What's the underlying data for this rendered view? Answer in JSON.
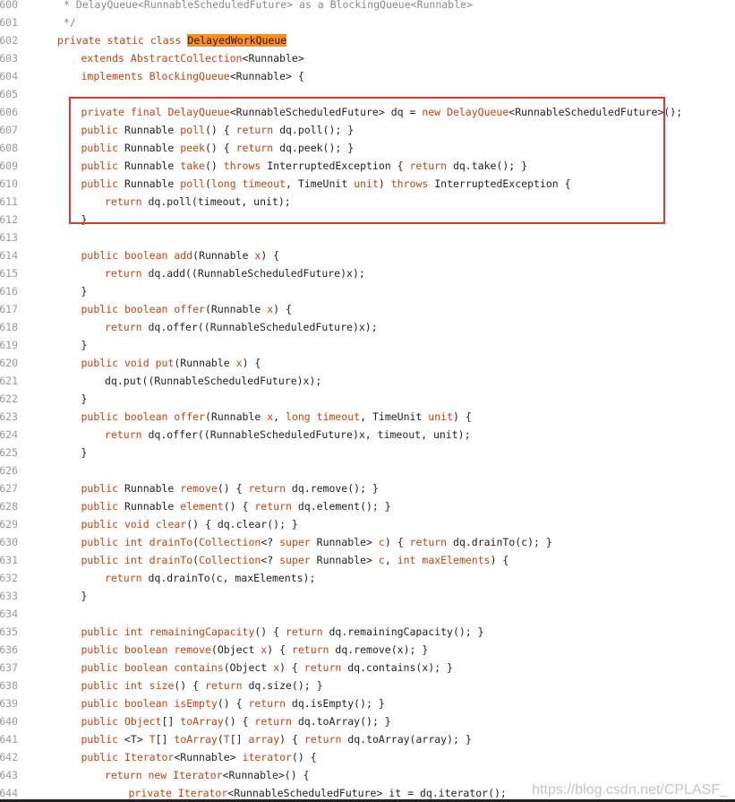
{
  "editor": {
    "lines": [
      {
        "num": "600",
        "indent": 0,
        "tokens": [
          [
            "cm",
            " * DelayQueue<RunnableScheduledFuture> as a BlockingQueue<Runnable>"
          ]
        ]
      },
      {
        "num": "601",
        "indent": 0,
        "tokens": [
          [
            "cm",
            " */"
          ]
        ]
      },
      {
        "num": "602",
        "indent": 0,
        "tokens": [
          [
            "kw",
            "private static class "
          ],
          [
            "hl",
            "DelayedWorkQueue"
          ]
        ]
      },
      {
        "num": "603",
        "indent": 1,
        "tokens": [
          [
            "kw",
            "extends "
          ],
          [
            "ty",
            "AbstractCollection"
          ],
          [
            "pl",
            "<Runnable>"
          ]
        ]
      },
      {
        "num": "604",
        "indent": 1,
        "tokens": [
          [
            "kw",
            "implements "
          ],
          [
            "ty",
            "BlockingQueue"
          ],
          [
            "pl",
            "<Runnable> {"
          ]
        ]
      },
      {
        "num": "605",
        "indent": 0,
        "tokens": []
      },
      {
        "num": "606",
        "indent": 1,
        "tokens": [
          [
            "kw",
            "private final "
          ],
          [
            "ty",
            "DelayQueue"
          ],
          [
            "pl",
            "<RunnableScheduledFuture> dq = "
          ],
          [
            "kw",
            "new "
          ],
          [
            "ty",
            "DelayQueue"
          ],
          [
            "pl",
            "<RunnableScheduledFuture>();"
          ]
        ]
      },
      {
        "num": "607",
        "indent": 1,
        "tokens": [
          [
            "kw",
            "public "
          ],
          [
            "pl",
            "Runnable "
          ],
          [
            "fn",
            "poll"
          ],
          [
            "pl",
            "() { "
          ],
          [
            "kw",
            "return "
          ],
          [
            "pl",
            "dq.poll(); }"
          ]
        ]
      },
      {
        "num": "608",
        "indent": 1,
        "tokens": [
          [
            "kw",
            "public "
          ],
          [
            "pl",
            "Runnable "
          ],
          [
            "fn",
            "peek"
          ],
          [
            "pl",
            "() { "
          ],
          [
            "kw",
            "return "
          ],
          [
            "pl",
            "dq.peek(); }"
          ]
        ]
      },
      {
        "num": "609",
        "indent": 1,
        "tokens": [
          [
            "kw",
            "public "
          ],
          [
            "pl",
            "Runnable "
          ],
          [
            "fn",
            "take"
          ],
          [
            "pl",
            "() "
          ],
          [
            "kw",
            "throws "
          ],
          [
            "pl",
            "InterruptedException { "
          ],
          [
            "kw",
            "return "
          ],
          [
            "pl",
            "dq.take(); }"
          ]
        ]
      },
      {
        "num": "610",
        "indent": 1,
        "tokens": [
          [
            "kw",
            "public "
          ],
          [
            "pl",
            "Runnable "
          ],
          [
            "fn",
            "poll"
          ],
          [
            "pl",
            "("
          ],
          [
            "kw",
            "long "
          ],
          [
            "vr",
            "timeout"
          ],
          [
            "pl",
            ", TimeUnit "
          ],
          [
            "vr",
            "unit"
          ],
          [
            "pl",
            ") "
          ],
          [
            "kw",
            "throws "
          ],
          [
            "pl",
            "InterruptedException {"
          ]
        ]
      },
      {
        "num": "611",
        "indent": 2,
        "tokens": [
          [
            "kw",
            "return "
          ],
          [
            "pl",
            "dq.poll(timeout, unit);"
          ]
        ]
      },
      {
        "num": "612",
        "indent": 1,
        "tokens": [
          [
            "pl",
            "}"
          ]
        ]
      },
      {
        "num": "613",
        "indent": 0,
        "tokens": []
      },
      {
        "num": "614",
        "indent": 1,
        "tokens": [
          [
            "kw",
            "public boolean "
          ],
          [
            "fn",
            "add"
          ],
          [
            "pl",
            "(Runnable "
          ],
          [
            "vr",
            "x"
          ],
          [
            "pl",
            ") {"
          ]
        ]
      },
      {
        "num": "615",
        "indent": 2,
        "tokens": [
          [
            "kw",
            "return "
          ],
          [
            "pl",
            "dq.add((RunnableScheduledFuture)x);"
          ]
        ]
      },
      {
        "num": "616",
        "indent": 1,
        "tokens": [
          [
            "pl",
            "}"
          ]
        ]
      },
      {
        "num": "617",
        "indent": 1,
        "tokens": [
          [
            "kw",
            "public boolean "
          ],
          [
            "fn",
            "offer"
          ],
          [
            "pl",
            "(Runnable "
          ],
          [
            "vr",
            "x"
          ],
          [
            "pl",
            ") {"
          ]
        ]
      },
      {
        "num": "618",
        "indent": 2,
        "tokens": [
          [
            "kw",
            "return "
          ],
          [
            "pl",
            "dq.offer((RunnableScheduledFuture)x);"
          ]
        ]
      },
      {
        "num": "619",
        "indent": 1,
        "tokens": [
          [
            "pl",
            "}"
          ]
        ]
      },
      {
        "num": "620",
        "indent": 1,
        "tokens": [
          [
            "kw",
            "public void "
          ],
          [
            "fn",
            "put"
          ],
          [
            "pl",
            "(Runnable "
          ],
          [
            "vr",
            "x"
          ],
          [
            "pl",
            ") {"
          ]
        ]
      },
      {
        "num": "621",
        "indent": 2,
        "tokens": [
          [
            "pl",
            "dq.put((RunnableScheduledFuture)x);"
          ]
        ]
      },
      {
        "num": "622",
        "indent": 1,
        "tokens": [
          [
            "pl",
            "}"
          ]
        ]
      },
      {
        "num": "623",
        "indent": 1,
        "tokens": [
          [
            "kw",
            "public boolean "
          ],
          [
            "fn",
            "offer"
          ],
          [
            "pl",
            "(Runnable "
          ],
          [
            "vr",
            "x"
          ],
          [
            "pl",
            ", "
          ],
          [
            "kw",
            "long "
          ],
          [
            "vr",
            "timeout"
          ],
          [
            "pl",
            ", TimeUnit "
          ],
          [
            "vr",
            "unit"
          ],
          [
            "pl",
            ") {"
          ]
        ]
      },
      {
        "num": "624",
        "indent": 2,
        "tokens": [
          [
            "kw",
            "return "
          ],
          [
            "pl",
            "dq.offer((RunnableScheduledFuture)x, timeout, unit);"
          ]
        ]
      },
      {
        "num": "625",
        "indent": 1,
        "tokens": [
          [
            "pl",
            "}"
          ]
        ]
      },
      {
        "num": "626",
        "indent": 0,
        "tokens": []
      },
      {
        "num": "627",
        "indent": 1,
        "tokens": [
          [
            "kw",
            "public "
          ],
          [
            "pl",
            "Runnable "
          ],
          [
            "fn",
            "remove"
          ],
          [
            "pl",
            "() { "
          ],
          [
            "kw",
            "return "
          ],
          [
            "pl",
            "dq.remove(); }"
          ]
        ]
      },
      {
        "num": "628",
        "indent": 1,
        "tokens": [
          [
            "kw",
            "public "
          ],
          [
            "pl",
            "Runnable "
          ],
          [
            "fn",
            "element"
          ],
          [
            "pl",
            "() { "
          ],
          [
            "kw",
            "return "
          ],
          [
            "pl",
            "dq.element(); }"
          ]
        ]
      },
      {
        "num": "629",
        "indent": 1,
        "tokens": [
          [
            "kw",
            "public void "
          ],
          [
            "fn",
            "clear"
          ],
          [
            "pl",
            "() { dq.clear(); }"
          ]
        ]
      },
      {
        "num": "630",
        "indent": 1,
        "tokens": [
          [
            "kw",
            "public int "
          ],
          [
            "fn",
            "drainTo"
          ],
          [
            "pl",
            "("
          ],
          [
            "ty",
            "Collection"
          ],
          [
            "pl",
            "<? "
          ],
          [
            "kw",
            "super "
          ],
          [
            "pl",
            "Runnable> "
          ],
          [
            "vr",
            "c"
          ],
          [
            "pl",
            ") { "
          ],
          [
            "kw",
            "return "
          ],
          [
            "pl",
            "dq.drainTo(c); }"
          ]
        ]
      },
      {
        "num": "631",
        "indent": 1,
        "tokens": [
          [
            "kw",
            "public int "
          ],
          [
            "fn",
            "drainTo"
          ],
          [
            "pl",
            "("
          ],
          [
            "ty",
            "Collection"
          ],
          [
            "pl",
            "<? "
          ],
          [
            "kw",
            "super "
          ],
          [
            "pl",
            "Runnable> "
          ],
          [
            "vr",
            "c"
          ],
          [
            "pl",
            ", "
          ],
          [
            "kw",
            "int "
          ],
          [
            "vr",
            "maxElements"
          ],
          [
            "pl",
            ") {"
          ]
        ]
      },
      {
        "num": "632",
        "indent": 2,
        "tokens": [
          [
            "kw",
            "return "
          ],
          [
            "pl",
            "dq.drainTo(c, maxElements);"
          ]
        ]
      },
      {
        "num": "633",
        "indent": 1,
        "tokens": [
          [
            "pl",
            "}"
          ]
        ]
      },
      {
        "num": "634",
        "indent": 0,
        "tokens": []
      },
      {
        "num": "635",
        "indent": 1,
        "tokens": [
          [
            "kw",
            "public int "
          ],
          [
            "fn",
            "remainingCapacity"
          ],
          [
            "pl",
            "() { "
          ],
          [
            "kw",
            "return "
          ],
          [
            "pl",
            "dq.remainingCapacity(); }"
          ]
        ]
      },
      {
        "num": "636",
        "indent": 1,
        "tokens": [
          [
            "kw",
            "public boolean "
          ],
          [
            "fn",
            "remove"
          ],
          [
            "pl",
            "(Object "
          ],
          [
            "vr",
            "x"
          ],
          [
            "pl",
            ") { "
          ],
          [
            "kw",
            "return "
          ],
          [
            "pl",
            "dq.remove(x); }"
          ]
        ]
      },
      {
        "num": "637",
        "indent": 1,
        "tokens": [
          [
            "kw",
            "public boolean "
          ],
          [
            "fn",
            "contains"
          ],
          [
            "pl",
            "(Object "
          ],
          [
            "vr",
            "x"
          ],
          [
            "pl",
            ") { "
          ],
          [
            "kw",
            "return "
          ],
          [
            "pl",
            "dq.contains(x); }"
          ]
        ]
      },
      {
        "num": "638",
        "indent": 1,
        "tokens": [
          [
            "kw",
            "public int "
          ],
          [
            "fn",
            "size"
          ],
          [
            "pl",
            "() { "
          ],
          [
            "kw",
            "return "
          ],
          [
            "pl",
            "dq.size(); }"
          ]
        ]
      },
      {
        "num": "639",
        "indent": 1,
        "tokens": [
          [
            "kw",
            "public boolean "
          ],
          [
            "fn",
            "isEmpty"
          ],
          [
            "pl",
            "() { "
          ],
          [
            "kw",
            "return "
          ],
          [
            "pl",
            "dq.isEmpty(); }"
          ]
        ]
      },
      {
        "num": "640",
        "indent": 1,
        "tokens": [
          [
            "kw",
            "public "
          ],
          [
            "ty",
            "Object"
          ],
          [
            "pl",
            "[] "
          ],
          [
            "fn",
            "toArray"
          ],
          [
            "pl",
            "() { "
          ],
          [
            "kw",
            "return "
          ],
          [
            "pl",
            "dq.toArray(); }"
          ]
        ]
      },
      {
        "num": "641",
        "indent": 1,
        "tokens": [
          [
            "kw",
            "public "
          ],
          [
            "pl",
            "<T> "
          ],
          [
            "ty",
            "T"
          ],
          [
            "pl",
            "[] "
          ],
          [
            "fn",
            "toArray"
          ],
          [
            "pl",
            "("
          ],
          [
            "ty",
            "T"
          ],
          [
            "pl",
            "[] "
          ],
          [
            "vr",
            "array"
          ],
          [
            "pl",
            ") { "
          ],
          [
            "kw",
            "return "
          ],
          [
            "pl",
            "dq.toArray(array); }"
          ]
        ]
      },
      {
        "num": "642",
        "indent": 1,
        "tokens": [
          [
            "kw",
            "public "
          ],
          [
            "ty",
            "Iterator"
          ],
          [
            "pl",
            "<Runnable> "
          ],
          [
            "fn",
            "iterator"
          ],
          [
            "pl",
            "() {"
          ]
        ]
      },
      {
        "num": "643",
        "indent": 2,
        "tokens": [
          [
            "kw",
            "return new "
          ],
          [
            "ty",
            "Iterator"
          ],
          [
            "pl",
            "<Runnable>() {"
          ]
        ]
      },
      {
        "num": "644",
        "indent": 3,
        "tokens": [
          [
            "kw",
            "private "
          ],
          [
            "ty",
            "Iterator"
          ],
          [
            "pl",
            "<RunnableScheduledFuture> it = dq.iterator();"
          ]
        ]
      }
    ]
  },
  "watermark": "https://blog.csdn.net/CPLASF_"
}
